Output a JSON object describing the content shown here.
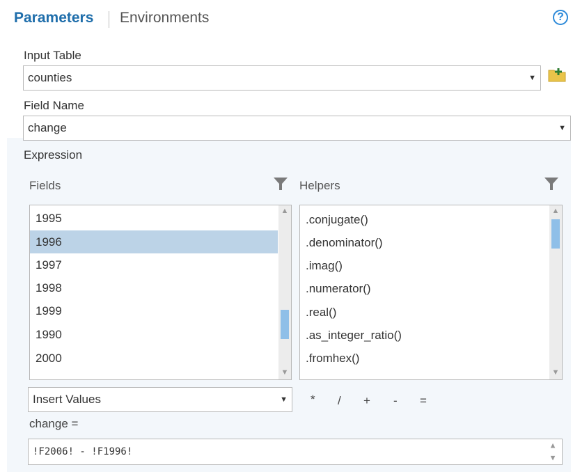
{
  "tabs": {
    "active": "Parameters",
    "inactive": "Environments"
  },
  "help_icon": "question-circle-icon",
  "input_table": {
    "label": "Input Table",
    "value": "counties"
  },
  "field_name": {
    "label": "Field Name",
    "value": "change"
  },
  "expression": {
    "label": "Expression",
    "fields_label": "Fields",
    "helpers_label": "Helpers",
    "fields": [
      "1995",
      "1996",
      "1997",
      "1998",
      "1999",
      "1990",
      "2000"
    ],
    "selected_field": "1996",
    "helpers": [
      ".conjugate()",
      ".denominator()",
      ".imag()",
      ".numerator()",
      ".real()",
      ".as_integer_ratio()",
      ".fromhex()"
    ],
    "insert_values": "Insert Values",
    "operators": [
      "*",
      "/",
      "+",
      "-",
      "="
    ],
    "target_label": "change =",
    "code": "!F2006! - !F1996!"
  },
  "colors": {
    "accent": "#1f6eab",
    "selection": "#bcd3e7",
    "scroll_thumb": "#8fbfe8"
  }
}
